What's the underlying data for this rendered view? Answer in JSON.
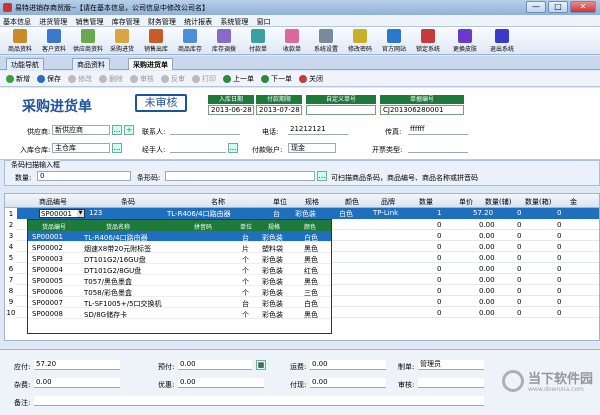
{
  "window": {
    "title": "易特进销存商贸版--【请在基本信息，公司信息中修改公司名】",
    "buttons": [
      "—",
      "□",
      "✕"
    ]
  },
  "menu": [
    "基本信息",
    "进货管理",
    "销售管理",
    "库存管理",
    "财务管理",
    "统计报表",
    "系统管理",
    "窗口"
  ],
  "toolbar": [
    {
      "label": "商品资料",
      "color": "#c98a2a"
    },
    {
      "label": "客户资料",
      "color": "#3a78c9"
    },
    {
      "label": "供应商资料",
      "color": "#6aa84f"
    },
    {
      "label": "采购进货",
      "color": "#d9a441"
    },
    {
      "label": "销售出库",
      "color": "#c95a2a"
    },
    {
      "label": "商品库存",
      "color": "#4a8fd9"
    },
    {
      "label": "库存调拨",
      "color": "#8a6ac9"
    },
    {
      "label": "付款单",
      "color": "#3aa0a0"
    },
    {
      "label": "收款单",
      "color": "#d96a9a"
    },
    {
      "label": "系统设置",
      "color": "#7a8a9a"
    },
    {
      "label": "修改密码",
      "color": "#c9b02a"
    },
    {
      "label": "官方网站",
      "color": "#2a7ac9"
    },
    {
      "label": "锁定系统",
      "color": "#c93a3a"
    },
    {
      "label": "更换皮肤",
      "color": "#6a3ac9"
    },
    {
      "label": "退出系统",
      "color": "#3a3ac9"
    }
  ],
  "tabs": [
    "功能导航",
    "商品资料",
    "采购进货单"
  ],
  "subtoolbar": [
    {
      "label": "新增",
      "color": "#3aa03a",
      "enabled": true
    },
    {
      "label": "保存",
      "color": "#2a6ac9",
      "enabled": true
    },
    {
      "label": "修改",
      "color": "#bbbbbb",
      "enabled": false
    },
    {
      "label": "删除",
      "color": "#bbbbbb",
      "enabled": false
    },
    {
      "label": "审核",
      "color": "#bbbbbb",
      "enabled": false
    },
    {
      "label": "反审",
      "color": "#bbbbbb",
      "enabled": false
    },
    {
      "label": "打印",
      "color": "#bbbbbb",
      "enabled": false
    },
    {
      "label": "上一单",
      "color": "#2a8a3a",
      "enabled": true
    },
    {
      "label": "下一单",
      "color": "#2a8a3a",
      "enabled": true
    },
    {
      "label": "关闭",
      "color": "#c93a3a",
      "enabled": true
    }
  ],
  "form": {
    "doc_title": "采购进货单",
    "stamp": "未审核",
    "headers": {
      "in_date": "入库日期",
      "pay_date": "付款期限",
      "custom_doc": "自定义单号",
      "doc_no": "单据编号"
    },
    "values": {
      "in_date": "2013-06-28",
      "pay_date": "2013-07-28",
      "custom_doc": "",
      "doc_no": "CJ201306280001"
    },
    "supplier_label": "供应商:",
    "supplier": "新供应商",
    "contact_label": "联系人:",
    "contact": "",
    "phone_label": "电话:",
    "phone": "21212121",
    "fax_label": "传真:",
    "fax": "ffffff",
    "warehouse_label": "入库仓库:",
    "warehouse": "主仓库",
    "handler_label": "经手人:",
    "handler": "",
    "pay_account_label": "付款账户:",
    "pay_account": "现金",
    "ticket_label": "开票类型:",
    "ticket": ""
  },
  "scan": {
    "legend": "条码扫描输入框",
    "qty_label": "数量:",
    "qty": "0",
    "barcode_label": "条形码:",
    "barcode": "",
    "hint": "可扫描商品条码，商品编号、商品名称或拼音码"
  },
  "grid": {
    "headers": [
      "商品编号",
      "条码",
      "名称",
      "单位",
      "规格",
      "颜色",
      "品牌",
      "数量",
      "单价",
      "数量(辅)",
      "数量(箱)",
      "金"
    ],
    "selected_row": {
      "num": "1",
      "code": "SP00001",
      "barcode": "123",
      "name": "TL-R406/4口路由器",
      "unit": "台",
      "spec": "彩色装",
      "color": "白色",
      "brand": "TP-Link",
      "qty": "1",
      "price": "57.20",
      "qty_aux": "0",
      "qty_box": "0"
    },
    "row_nums": [
      "1",
      "2",
      "3",
      "4",
      "5",
      "6",
      "7",
      "8",
      "9",
      "10"
    ],
    "rows": [
      {
        "qty": "0",
        "price": "0.00",
        "qty_aux": "0",
        "qty_box": "0"
      },
      {
        "qty": "0",
        "price": "0.00",
        "qty_aux": "0",
        "qty_box": "0"
      },
      {
        "qty": "0",
        "price": "0.00",
        "qty_aux": "0",
        "qty_box": "0"
      },
      {
        "qty": "0",
        "price": "0.00",
        "qty_aux": "0",
        "qty_box": "0"
      },
      {
        "qty": "0",
        "price": "0.00",
        "qty_aux": "0",
        "qty_box": "0"
      },
      {
        "qty": "0",
        "price": "0.00",
        "qty_aux": "0",
        "qty_box": "0"
      },
      {
        "qty": "0",
        "price": "0.00",
        "qty_aux": "0",
        "qty_box": "0"
      },
      {
        "qty": "0",
        "price": "0.00",
        "qty_aux": "0",
        "qty_box": "0"
      },
      {
        "qty": "0",
        "price": "0.00",
        "qty_aux": "0",
        "qty_box": "0"
      }
    ]
  },
  "dropdown": {
    "headers": [
      "货品编号",
      "货品名称",
      "拼音码",
      "单位",
      "规格",
      "颜色"
    ],
    "items": [
      {
        "code": "SP00001",
        "name": "TL-R406/4口路由器",
        "py": "",
        "unit": "台",
        "spec": "彩色装",
        "color": "白色",
        "selected": true
      },
      {
        "code": "SP00002",
        "name": "烟速X8带20元附标签",
        "py": "",
        "unit": "片",
        "spec": "塑料袋",
        "color": "黑色",
        "selected": false
      },
      {
        "code": "SP00003",
        "name": "DT101G2/16GU盘",
        "py": "",
        "unit": "个",
        "spec": "彩色装",
        "color": "黑色",
        "selected": false
      },
      {
        "code": "SP00004",
        "name": "DT101G2/8GU盘",
        "py": "",
        "unit": "个",
        "spec": "彩色装",
        "color": "红色",
        "selected": false
      },
      {
        "code": "SP00005",
        "name": "T057/黑色墨盒",
        "py": "",
        "unit": "个",
        "spec": "彩色装",
        "color": "黑色",
        "selected": false
      },
      {
        "code": "SP00006",
        "name": "T058/彩色墨盒",
        "py": "",
        "unit": "个",
        "spec": "彩色装",
        "color": "三色",
        "selected": false
      },
      {
        "code": "SP00007",
        "name": "TL-SF1005+/5口交换机",
        "py": "",
        "unit": "台",
        "spec": "彩色装",
        "color": "白色",
        "selected": false
      },
      {
        "code": "SP00008",
        "name": "SD/8G储存卡",
        "py": "",
        "unit": "个",
        "spec": "彩色装",
        "color": "黑色",
        "selected": false
      }
    ]
  },
  "footer": {
    "payable_label": "应付:",
    "payable": "57.20",
    "prepay_label": "预付:",
    "prepay": "0.00",
    "freight_label": "运费:",
    "freight": "0.00",
    "maker_label": "制单:",
    "maker": "管理员",
    "misc_label": "杂费:",
    "misc": "0.00",
    "discount_label": "优惠:",
    "discount": "0.00",
    "paid_label": "付现:",
    "paid": "0.00",
    "auditor_label": "审核:",
    "auditor": "",
    "note_label": "备注:",
    "note": ""
  },
  "watermark": {
    "title": "当下软件园",
    "url": "www.downxia.com"
  }
}
